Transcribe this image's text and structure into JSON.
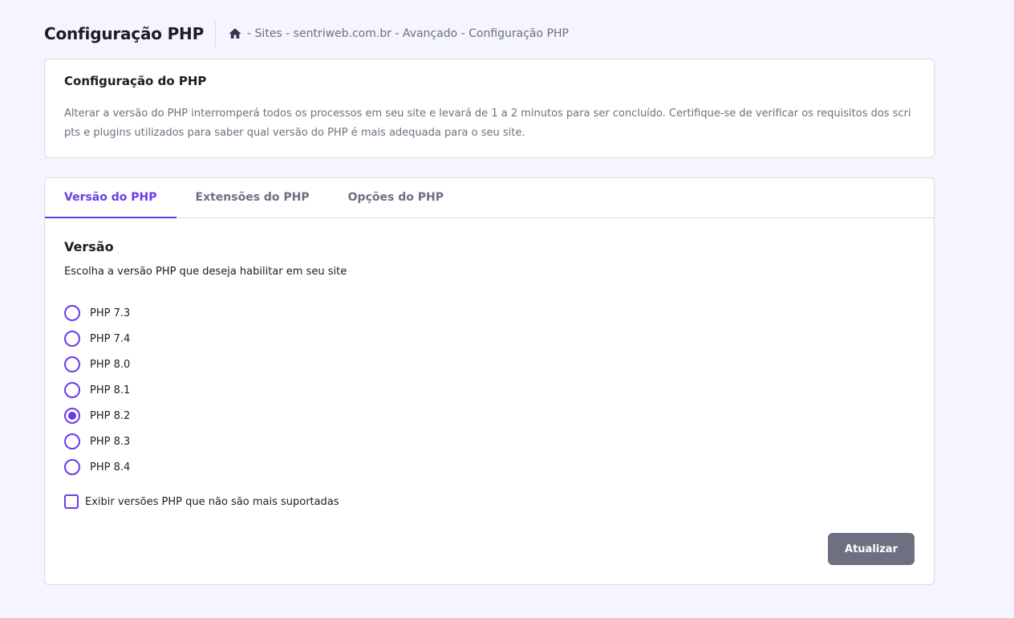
{
  "header": {
    "title": "Configuração PHP",
    "breadcrumb": "- Sites - sentriweb.com.br - Avançado - Configuração PHP"
  },
  "info_card": {
    "title": "Configuração do PHP",
    "text": "Alterar a versão do PHP interromperá todos os processos em seu site e levará de 1 a 2 minutos para ser concluído. Certifique-se de verificar os requisitos dos scripts e plugins utilizados para saber qual versão do PHP é mais adequada para o seu site."
  },
  "tabs": [
    {
      "label": "Versão do PHP",
      "active": true
    },
    {
      "label": "Extensões do PHP",
      "active": false
    },
    {
      "label": "Opções do PHP",
      "active": false
    }
  ],
  "version_section": {
    "title": "Versão",
    "description": "Escolha a versão PHP que deseja habilitar em seu site",
    "options": [
      {
        "label": "PHP 7.3",
        "selected": false
      },
      {
        "label": "PHP 7.4",
        "selected": false
      },
      {
        "label": "PHP 8.0",
        "selected": false
      },
      {
        "label": "PHP 8.1",
        "selected": false
      },
      {
        "label": "PHP 8.2",
        "selected": true
      },
      {
        "label": "PHP 8.3",
        "selected": false
      },
      {
        "label": "PHP 8.4",
        "selected": false
      }
    ],
    "show_unsupported_label": "Exibir versões PHP que não são mais suportadas",
    "show_unsupported_checked": false
  },
  "actions": {
    "update_label": "Atualizar"
  },
  "colors": {
    "accent": "#673de6",
    "background": "#f4f5ff",
    "button_disabled": "#6d7081"
  },
  "icons": {
    "breadcrumb_home": "home-icon"
  }
}
